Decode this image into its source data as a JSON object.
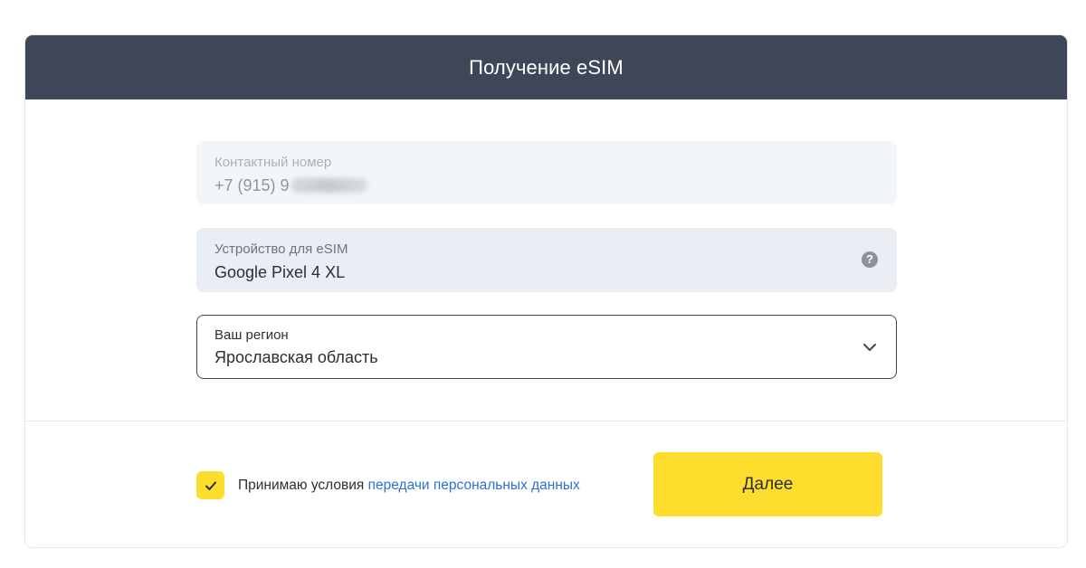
{
  "header": {
    "title": "Получение eSIM"
  },
  "form": {
    "phone": {
      "label": "Контактный номер",
      "value_visible": "+7 (915) 9",
      "redacted": true
    },
    "device": {
      "label": "Устройство для eSIM",
      "value": "Google Pixel 4 XL",
      "icon": "help-icon"
    },
    "region": {
      "label": "Ваш регион",
      "value": "Ярославская область",
      "icon": "chevron-down-icon"
    }
  },
  "footer": {
    "consent_checked": true,
    "consent_text": "Принимаю условия ",
    "consent_link": "передачи персональных данных",
    "next_label": "Далее"
  },
  "colors": {
    "header_bg": "#3e4757",
    "accent_yellow": "#ffdd2d",
    "link_blue": "#2a6fdb"
  }
}
